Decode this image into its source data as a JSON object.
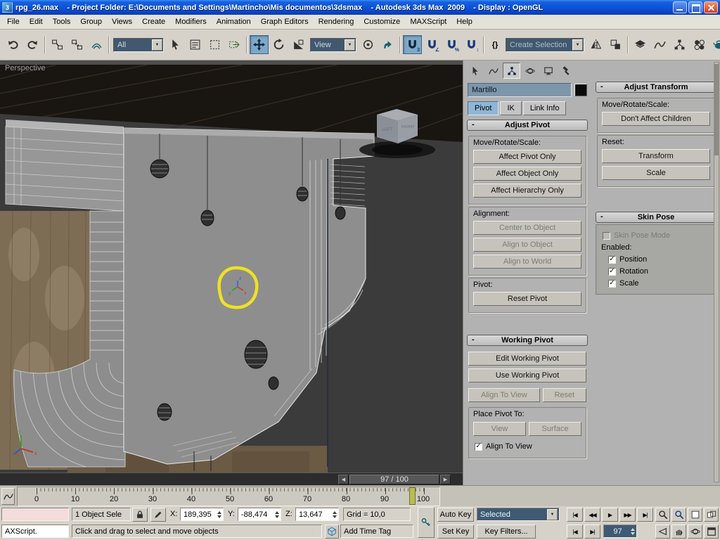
{
  "window": {
    "title": "rpg_26.max    - Project Folder: E:\\Documents and Settings\\Martincho\\Mis documentos\\3dsmax    - Autodesk 3ds Max  2009    - Display : OpenGL"
  },
  "menu": {
    "items": [
      "File",
      "Edit",
      "Tools",
      "Group",
      "Views",
      "Create",
      "Modifiers",
      "Animation",
      "Graph Editors",
      "Rendering",
      "Customize",
      "MAXScript",
      "Help"
    ]
  },
  "toolbar": {
    "selection_filter": "All",
    "reference_coordsys": "View",
    "named_selection_sets": "Create Selection Set"
  },
  "viewport": {
    "label": "Perspective",
    "cube_left": "LEFT",
    "cube_front": "FRONT",
    "time_slider": "97 / 100"
  },
  "panel": {
    "object_name": "Martillo",
    "tabs": {
      "pivot": "Pivot",
      "ik": "IK",
      "link_info": "Link Info"
    },
    "adjust_pivot": {
      "title": "Adjust Pivot",
      "mrs_label": "Move/Rotate/Scale:",
      "affect_pivot": "Affect Pivot Only",
      "affect_object": "Affect Object Only",
      "affect_hierarchy": "Affect Hierarchy Only",
      "alignment_label": "Alignment:",
      "center_to_object": "Center to Object",
      "align_to_object": "Align to Object",
      "align_to_world": "Align to World",
      "pivot_label": "Pivot:",
      "reset_pivot": "Reset Pivot"
    },
    "working_pivot": {
      "title": "Working Pivot",
      "edit": "Edit Working Pivot",
      "use": "Use Working Pivot",
      "align_to_view": "Align To View",
      "reset": "Reset",
      "place_label": "Place Pivot To:",
      "view": "View",
      "surface": "Surface",
      "align_checkbox": "Align To View"
    },
    "adjust_transform": {
      "title": "Adjust Transform",
      "mrs_label": "Move/Rotate/Scale:",
      "dont_affect": "Don't Affect Children",
      "reset_label": "Reset:",
      "transform": "Transform",
      "scale": "Scale"
    },
    "skin_pose": {
      "title": "Skin Pose",
      "mode": "Skin Pose Mode",
      "enabled_label": "Enabled:",
      "position": "Position",
      "rotation": "Rotation",
      "scale": "Scale"
    }
  },
  "timeline": {
    "ticks": [
      "0",
      "10",
      "20",
      "30",
      "40",
      "50",
      "60",
      "70",
      "80",
      "90",
      "100"
    ],
    "current_frame": 97
  },
  "status": {
    "listener": "AXScript.",
    "selection_count": "1 Object Sele",
    "x_label": "X:",
    "x_value": "189,395",
    "y_label": "Y:",
    "y_value": "-88,474",
    "z_label": "Z:",
    "z_value": "13,647",
    "grid": "Grid = 10,0",
    "prompt": "Click and drag to select and move objects",
    "add_time_tag": "Add Time Tag",
    "auto_key": "Auto Key",
    "set_key": "Set Key",
    "key_mode": "Selected",
    "key_filters": "Key Filters...",
    "frame": "97"
  },
  "icons": {
    "minus": "-",
    "check": "✓",
    "combo_arrow": "▼",
    "braces": "{}",
    "snap_badge_3": "3",
    "snap_badge_angle": "∠",
    "snap_badge_percent": "%",
    "snap_badge_spinner": "↕",
    "ts_left": "◀",
    "ts_right": "▶",
    "play_start": "|◀",
    "prev_frame": "◀◀",
    "play": "▶",
    "next_frame": "▶▶",
    "play_end": "▶|",
    "prev_key": "|◀",
    "next_key": "▶|"
  }
}
